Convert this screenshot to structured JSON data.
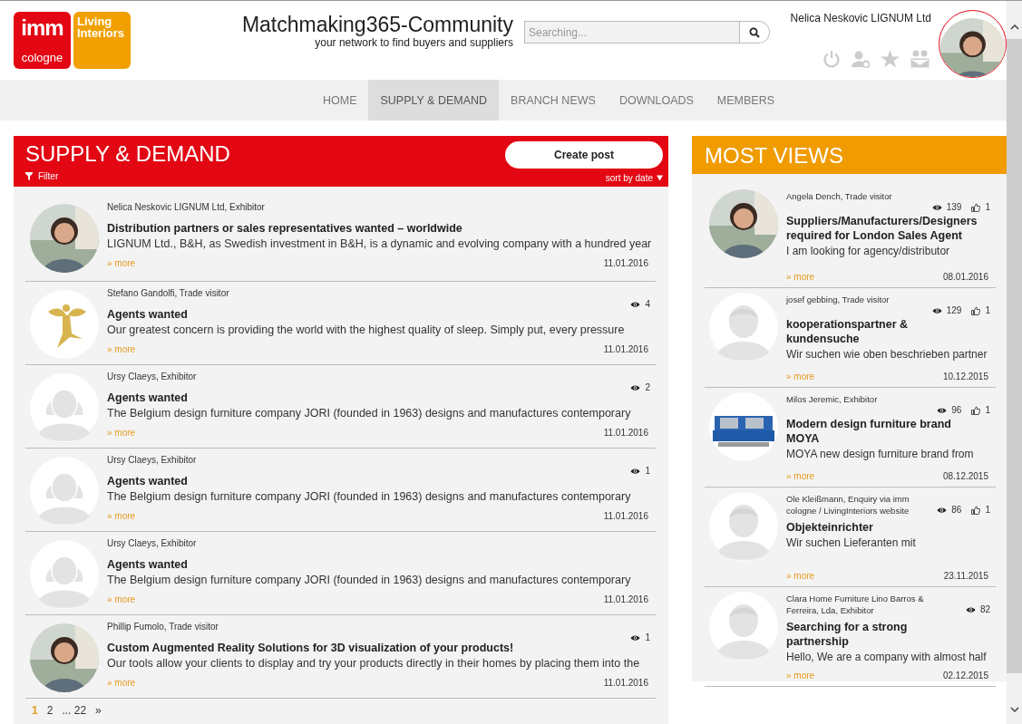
{
  "header": {
    "logo": {
      "mark": "imm",
      "city": "cologne",
      "brand": "Living Interiors"
    },
    "title": "Matchmaking365-Community",
    "tagline": "your network to find buyers and suppliers",
    "search": {
      "placeholder": "Searching..."
    },
    "user": {
      "name": "Nelica Neskovic LIGNUM Ltd"
    }
  },
  "nav": [
    {
      "label": "HOME",
      "selected": false
    },
    {
      "label": "SUPPLY & DEMAND",
      "selected": true
    },
    {
      "label": "BRANCH NEWS",
      "selected": false
    },
    {
      "label": "DOWNLOADS",
      "selected": false
    },
    {
      "label": "MEMBERS",
      "selected": false
    }
  ],
  "supply_demand": {
    "title": "SUPPLY & DEMAND",
    "filter": "Filter",
    "create_button": "Create post",
    "sort": "sort by date",
    "posts": [
      {
        "author": "Nelica Neskovic LIGNUM Ltd, Exhibitor",
        "title": "Distribution partners or sales representatives wanted – worldwide",
        "snippet": "LIGNUM Ltd., B&H, as Swedish investment in B&H, is a dynamic and evolving company with a hundred year",
        "more": "» more",
        "date": "11.01.2016"
      },
      {
        "kind": "angel",
        "author": "Stefano Gandolfi, Trade visitor",
        "views": "4",
        "title": "Agents wanted",
        "snippet": "Our greatest concern is providing the world with the highest quality of sleep. Simply put, every pressure",
        "more": "» more",
        "date": "11.01.2016"
      },
      {
        "kind": "female",
        "author": "Ursy Claeys, Exhibitor",
        "views": "2",
        "title": "Agents wanted",
        "snippet": "The Belgium design furniture company JORI (founded in 1963) designs and manufactures contemporary",
        "more": "» more",
        "date": "11.01.2016"
      },
      {
        "kind": "female",
        "author": "Ursy Claeys, Exhibitor",
        "views": "1",
        "title": "Agents wanted",
        "snippet": "The Belgium design furniture company JORI (founded in 1963) designs and manufactures contemporary",
        "more": "» more",
        "date": "11.01.2016"
      },
      {
        "kind": "female",
        "author": "Ursy Claeys, Exhibitor",
        "title": "Agents wanted",
        "snippet": "The Belgium design furniture company JORI (founded in 1963) designs and manufactures contemporary",
        "more": "» more",
        "date": "11.01.2016"
      },
      {
        "author": "Phillip Fumolo, Trade visitor",
        "views": "1",
        "title": "Custom Augmented Reality Solutions for 3D visualization of your products!",
        "snippet": "Our tools allow your clients to display and try your products directly in their homes by placing them into the",
        "more": "» more",
        "date": "11.01.2016"
      }
    ],
    "pagination": [
      {
        "label": "1",
        "selected": true
      },
      {
        "label": "2",
        "selected": false
      },
      {
        "label": "... 22",
        "selected": false
      },
      {
        "label": "»",
        "selected": false
      }
    ]
  },
  "most_views": {
    "title": "MOST VIEWS",
    "posts": [
      {
        "author": "Angela Dench, Trade visitor",
        "views": "139",
        "likes": "1",
        "title": "Suppliers/Manufacturers/Designers required for London Sales Agent",
        "snippet": "I am looking for agency/distributor",
        "more": "» more",
        "date": "08.01.2016"
      },
      {
        "kind": "male",
        "author": "josef gebbing, Trade visitor",
        "views": "129",
        "likes": "1",
        "title": "kooperationspartner & kundensuche",
        "snippet": "Wir suchen wie oben beschrieben partner",
        "more": "» more",
        "date": "10.12.2015"
      },
      {
        "kind": "sofa",
        "author": "Milos Jeremic, Exhibitor",
        "views": "96",
        "likes": "1",
        "title": "Modern design furniture brand MOYA",
        "snippet": "MOYA new design furniture brand from",
        "more": "» more",
        "date": "08.12.2015"
      },
      {
        "kind": "male",
        "author": "Ole Kleißmann, Enquiry via imm cologne / LivingInteriors website",
        "views": "86",
        "likes": "1",
        "title": "Objekteinrichter",
        "snippet": "Wir suchen Lieferanten mit",
        "more": "» more",
        "date": "23.11.2015"
      },
      {
        "kind": "male",
        "author": "Clara Home Furniture Lino Barros & Ferreira, Lda, Exhibitor",
        "views": "82",
        "title": "Searching for a strong partnership",
        "snippet": "Hello, We are a company with almost half",
        "more": "» more",
        "date": "02.12.2015"
      }
    ]
  }
}
